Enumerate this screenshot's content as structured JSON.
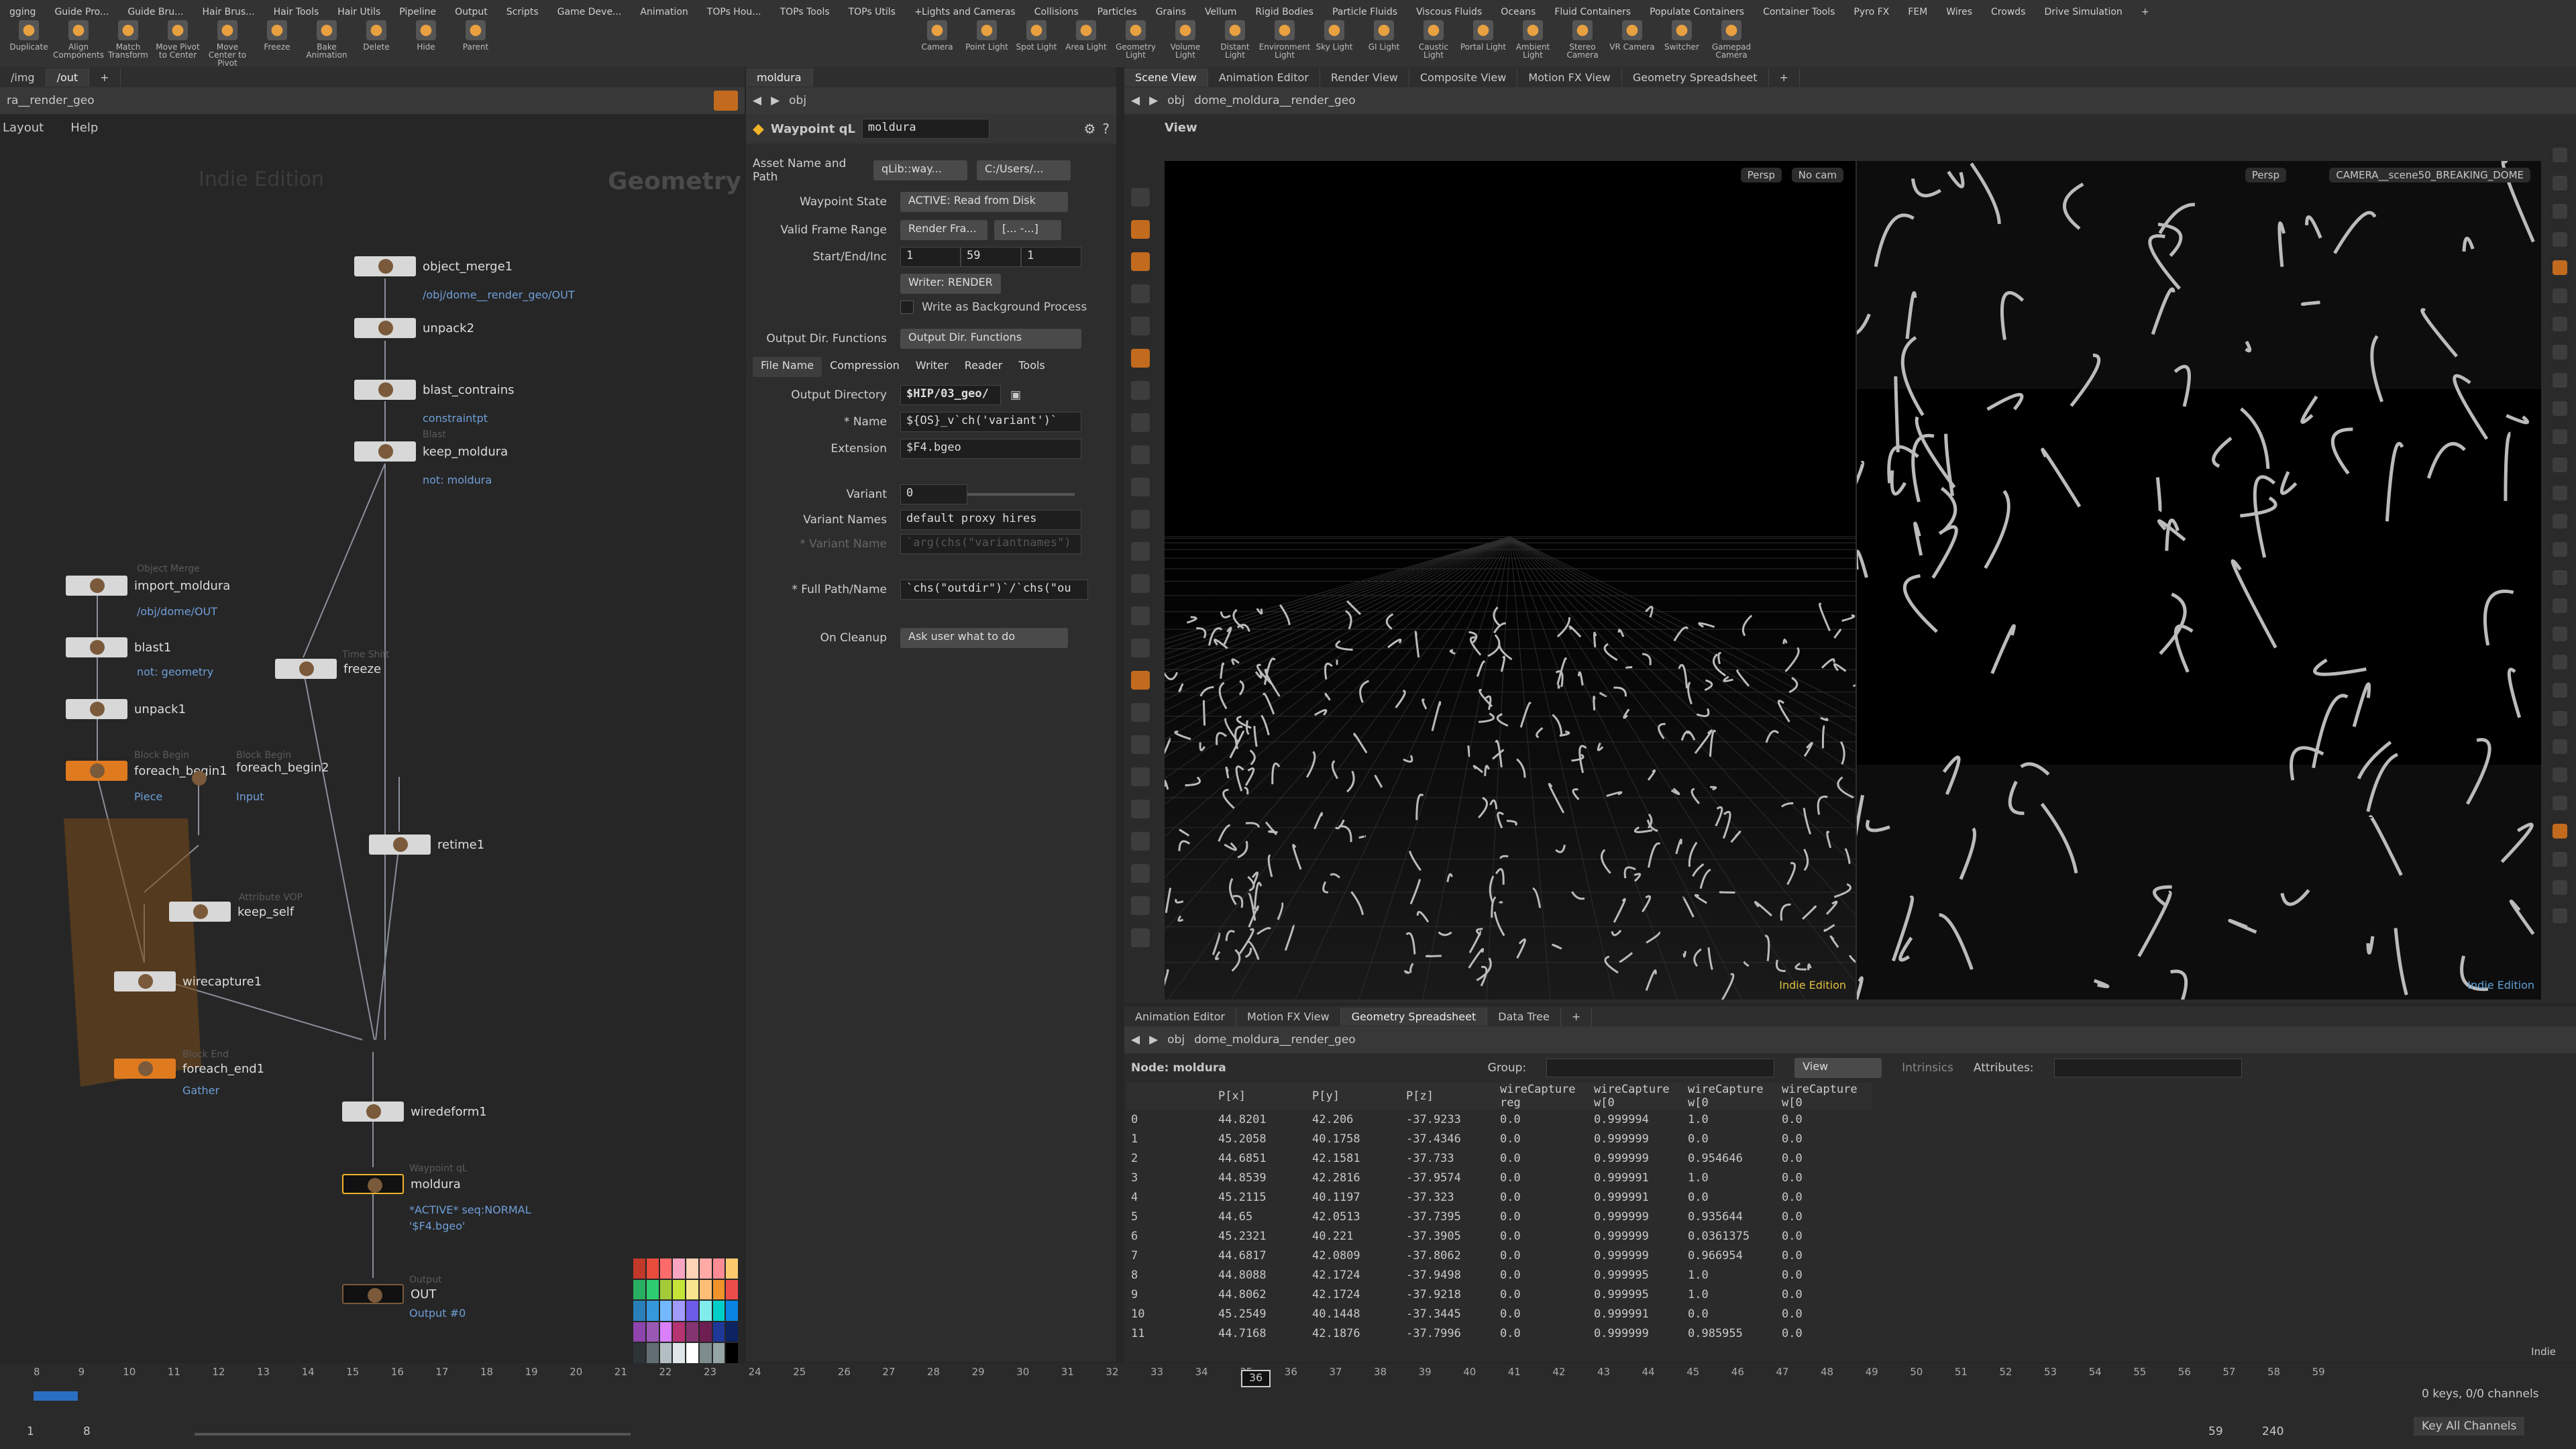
{
  "shelf": {
    "left_tabs": [
      "gging",
      "Guide Pro...",
      "Guide Bru...",
      "Hair Brus...",
      "Hair Tools",
      "Hair Utils",
      "Pipeline",
      "Output",
      "Scripts",
      "Game Deve...",
      "Animation",
      "TOPs Hou...",
      "TOPs Tools",
      "TOPs Utils",
      "+"
    ],
    "left_tools": [
      {
        "label": "Duplicate",
        "icon": "duplicate-icon"
      },
      {
        "label": "Align Components",
        "icon": "align-icon"
      },
      {
        "label": "Match Transform",
        "icon": "match-icon"
      },
      {
        "label": "Move Pivot to Center",
        "icon": "pivot-icon"
      },
      {
        "label": "Move Center to Pivot",
        "icon": "pivot2-icon"
      },
      {
        "label": "Freeze",
        "icon": "freeze-icon"
      },
      {
        "label": "Bake Animation",
        "icon": "bake-icon"
      },
      {
        "label": "Delete",
        "icon": "delete-icon"
      },
      {
        "label": "Hide",
        "icon": "hide-icon"
      },
      {
        "label": "Parent",
        "icon": "parent-icon"
      }
    ],
    "right_tabs": [
      "Lights and Cameras",
      "Collisions",
      "Particles",
      "Grains",
      "Vellum",
      "Rigid Bodies",
      "Particle Fluids",
      "Viscous Fluids",
      "Oceans",
      "Fluid Containers",
      "Populate Containers",
      "Container Tools",
      "Pyro FX",
      "FEM",
      "Wires",
      "Crowds",
      "Drive Simulation",
      "+"
    ],
    "right_tools": [
      {
        "label": "Camera",
        "icon": "camera-icon"
      },
      {
        "label": "Point Light",
        "icon": "point-light-icon"
      },
      {
        "label": "Spot Light",
        "icon": "spot-light-icon"
      },
      {
        "label": "Area Light",
        "icon": "area-light-icon"
      },
      {
        "label": "Geometry Light",
        "icon": "geo-light-icon"
      },
      {
        "label": "Volume Light",
        "icon": "volume-light-icon"
      },
      {
        "label": "Distant Light",
        "icon": "distant-light-icon"
      },
      {
        "label": "Environment Light",
        "icon": "env-light-icon"
      },
      {
        "label": "Sky Light",
        "icon": "sky-light-icon"
      },
      {
        "label": "GI Light",
        "icon": "gi-light-icon"
      },
      {
        "label": "Caustic Light",
        "icon": "caustic-light-icon"
      },
      {
        "label": "Portal Light",
        "icon": "portal-light-icon"
      },
      {
        "label": "Ambient Light",
        "icon": "ambient-light-icon"
      },
      {
        "label": "Stereo Camera",
        "icon": "stereo-camera-icon"
      },
      {
        "label": "VR Camera",
        "icon": "vr-camera-icon"
      },
      {
        "label": "Switcher",
        "icon": "switcher-icon"
      },
      {
        "label": "Gamepad Camera",
        "icon": "gamepad-icon"
      }
    ]
  },
  "network": {
    "tabs": [
      "/img",
      "/out",
      "+"
    ],
    "path": "ra__render_geo",
    "menu": [
      "Layout",
      "Help"
    ],
    "watermark": "Indie Edition",
    "context": "Geometry",
    "nodes": [
      {
        "name": "object_merge1",
        "sub": "/obj/dome__render_geo/OUT",
        "type": ""
      },
      {
        "name": "unpack2",
        "sub": "",
        "type": ""
      },
      {
        "name": "blast_contrains",
        "sub": "constraintpt",
        "type": ""
      },
      {
        "name": "keep_moldura",
        "sub": "not: moldura",
        "type": "Blast"
      },
      {
        "name": "import_moldura",
        "sub": "/obj/dome/OUT",
        "type": "Object Merge"
      },
      {
        "name": "blast1",
        "sub": "not: geometry",
        "type": ""
      },
      {
        "name": "freeze",
        "sub": "",
        "type": "Time Shift"
      },
      {
        "name": "unpack1",
        "sub": "",
        "type": ""
      },
      {
        "name": "foreach_begin1",
        "sub": "Piece",
        "type": "Block Begin"
      },
      {
        "name": "foreach_begin2",
        "sub": "Input",
        "type": "Block Begin"
      },
      {
        "name": "retime1",
        "sub": "",
        "type": ""
      },
      {
        "name": "keep_self",
        "sub": "",
        "type": "Attribute VOP"
      },
      {
        "name": "wirecapture1",
        "sub": "",
        "type": ""
      },
      {
        "name": "foreach_end1",
        "sub": "Gather",
        "type": "Block End"
      },
      {
        "name": "wiredeform1",
        "sub": "",
        "type": ""
      },
      {
        "name": "moldura",
        "sub": "*ACTIVE* seq:NORMAL",
        "sub2": "'$F4.bgeo'",
        "type": "Waypoint qL"
      },
      {
        "name": "OUT",
        "sub": "Output #0",
        "type": "Output"
      }
    ]
  },
  "params": {
    "tab": "moldura",
    "path": "obj",
    "node_type": "Waypoint qL",
    "node_name": "moldura",
    "asset_label": "Asset Name and Path",
    "asset_value": "qLib::way...",
    "asset_path": "C:/Users/...",
    "rows": [
      {
        "label": "Waypoint State",
        "value": "ACTIVE: Read from Disk"
      },
      {
        "label": "Valid Frame Range",
        "value": "Render Fra...",
        "extra": "[... -...]"
      },
      {
        "label": "Start/End/Inc",
        "v1": "1",
        "v2": "59",
        "v3": "1"
      }
    ],
    "writer_button": "Writer: RENDER",
    "bg_process": "Write as Background Process",
    "outdir_label": "Output Dir. Functions",
    "outdir_value": "Output Dir. Functions",
    "subtabs": [
      "File Name",
      "Compression",
      "Writer",
      "Reader",
      "Tools"
    ],
    "output_directory_label": "Output Directory",
    "output_directory": "$HIP/03_geo/",
    "name_label": "* Name",
    "name_value": "${OS}_v`ch('variant')`",
    "extension_label": "Extension",
    "extension_value": "$F4.bgeo",
    "variant_label": "Variant",
    "variant_value": "0",
    "variant_names_label": "Variant Names",
    "variant_names_value": "default proxy hires",
    "variant_name_label": "* Variant Name",
    "variant_name_value": "`arg(chs(\"variantnames\")",
    "full_path_label": "* Full Path/Name",
    "full_path_value": "`chs(\"outdir\")`/`chs(\"ou",
    "cleanup_label": "On Cleanup",
    "cleanup_value": "Ask user what to do"
  },
  "viewer": {
    "tabs": [
      "Scene View",
      "Animation Editor",
      "Render View",
      "Composite View",
      "Motion FX View",
      "Geometry Spreadsheet",
      "+"
    ],
    "path_obj": "obj",
    "path_geo": "dome_moldura__render_geo",
    "view_label": "View",
    "left_persp": "Persp",
    "left_cam": "No cam",
    "right_persp": "Persp",
    "right_cam": "CAMERA__scene50_BREAKING_DOME",
    "indie": "Indie Edition"
  },
  "spreadsheet": {
    "tabs": [
      "Animation Editor",
      "Motion FX View",
      "Geometry Spreadsheet",
      "Data Tree",
      "+"
    ],
    "path_obj": "obj",
    "path_geo": "dome_moldura__render_geo",
    "node_label": "Node: moldura",
    "group_label": "Group:",
    "view_label": "View",
    "intrinsics_label": "Intrinsics",
    "attributes_label": "Attributes:",
    "columns": [
      "",
      "P[x]",
      "P[y]",
      "P[z]",
      "wireCapture reg",
      "wireCapture w[0",
      "wireCapture w[0",
      "wireCapture w[0"
    ],
    "rows": [
      [
        "0",
        "44.8201",
        "42.206",
        "-37.9233",
        "0.0",
        "0.999994",
        "1.0",
        "0.0"
      ],
      [
        "1",
        "45.2058",
        "40.1758",
        "-37.4346",
        "0.0",
        "0.999999",
        "0.0",
        "0.0"
      ],
      [
        "2",
        "44.6851",
        "42.1581",
        "-37.733",
        "0.0",
        "0.999999",
        "0.954646",
        "0.0"
      ],
      [
        "3",
        "44.8539",
        "42.2816",
        "-37.9574",
        "0.0",
        "0.999991",
        "1.0",
        "0.0"
      ],
      [
        "4",
        "45.2115",
        "40.1197",
        "-37.323",
        "0.0",
        "0.999991",
        "0.0",
        "0.0"
      ],
      [
        "5",
        "44.65",
        "42.0513",
        "-37.7395",
        "0.0",
        "0.999999",
        "0.935644",
        "0.0"
      ],
      [
        "6",
        "45.2321",
        "40.221",
        "-37.3905",
        "0.0",
        "0.999999",
        "0.0361375",
        "0.0"
      ],
      [
        "7",
        "44.6817",
        "42.0809",
        "-37.8062",
        "0.0",
        "0.999999",
        "0.966954",
        "0.0"
      ],
      [
        "8",
        "44.8088",
        "42.1724",
        "-37.9498",
        "0.0",
        "0.999995",
        "1.0",
        "0.0"
      ],
      [
        "9",
        "44.8062",
        "42.1724",
        "-37.9218",
        "0.0",
        "0.999995",
        "1.0",
        "0.0"
      ],
      [
        "10",
        "45.2549",
        "40.1448",
        "-37.3445",
        "0.0",
        "0.999991",
        "0.0",
        "0.0"
      ],
      [
        "11",
        "44.7168",
        "42.1876",
        "-37.7996",
        "0.0",
        "0.999999",
        "0.985955",
        "0.0"
      ]
    ],
    "indie": "Indie"
  },
  "timeline": {
    "ticks": [
      "8",
      "9",
      "10",
      "11",
      "12",
      "13",
      "14",
      "15",
      "16",
      "17",
      "18",
      "19",
      "20",
      "21",
      "22",
      "23",
      "24",
      "25",
      "26",
      "27",
      "28",
      "29",
      "30",
      "31",
      "32",
      "33",
      "34",
      "35",
      "36",
      "37",
      "38",
      "39",
      "40",
      "41",
      "42",
      "43",
      "44",
      "45",
      "46",
      "47",
      "48",
      "49",
      "50",
      "51",
      "52",
      "53",
      "54",
      "55",
      "56",
      "57",
      "58",
      "59"
    ],
    "current_frame": "36",
    "start": "1",
    "range_start": "8",
    "range_end": "59",
    "end": "240",
    "keys_label": "0 keys, 0/0 channels",
    "key_all": "Key All Channels"
  },
  "colors": {
    "accent": "#e07a1f",
    "link": "#6f9fd8",
    "bg": "#262626"
  }
}
